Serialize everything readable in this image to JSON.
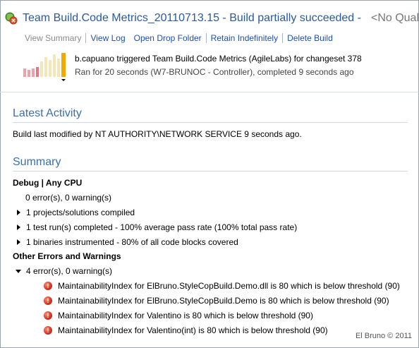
{
  "header": {
    "title": "Team Build.Code Metrics_20110713.15 - Build partially succeeded -",
    "quality": "<No Quali"
  },
  "links": [
    "View Summary",
    "View Log",
    "Open Drop Folder",
    "Retain Indefinitely",
    "Delete Build"
  ],
  "build_summary": {
    "line1": "b.capuano triggered Team Build.Code Metrics (AgileLabs) for changeset 378",
    "line2": "Ran for 20 seconds (W7-BRUNOC - Controller), completed 9 seconds ago"
  },
  "latest_activity": {
    "heading": "Latest Activity",
    "text": "Build last modified by NT AUTHORITY\\NETWORK SERVICE 9 seconds ago."
  },
  "summary": {
    "heading": "Summary",
    "config_heading": "Debug | Any CPU",
    "errors_warnings": "0 error(s), 0 warning(s)",
    "projects": "1 projects/solutions compiled",
    "tests": "1 test run(s) completed - 100% average pass rate (100% total pass rate)",
    "binaries": "1 binaries instrumented - 80% of all code blocks covered",
    "other_heading": "Other Errors and Warnings",
    "other_count": "4 error(s), 0 warning(s)",
    "errors": [
      "MaintainabilityIndex for ElBruno.StyleCopBuild.Demo.dll is 80 which is below threshold (90)",
      "MaintainabilityIndex for ElBruno.StyleCopBuild.Demo is 80 which is below threshold (90)",
      "MaintainabilityIndex for Valentino is 80 which is below threshold (90)",
      "MaintainabilityIndex for Valentino(int) is 80 which is below threshold (90)"
    ]
  },
  "footer": {
    "copyright": "El Bruno © 2011"
  },
  "colors": {
    "title": "#2a5a9e",
    "link": "#1f4fb4",
    "heading": "#3a6fb0",
    "error": "#d2301e"
  }
}
